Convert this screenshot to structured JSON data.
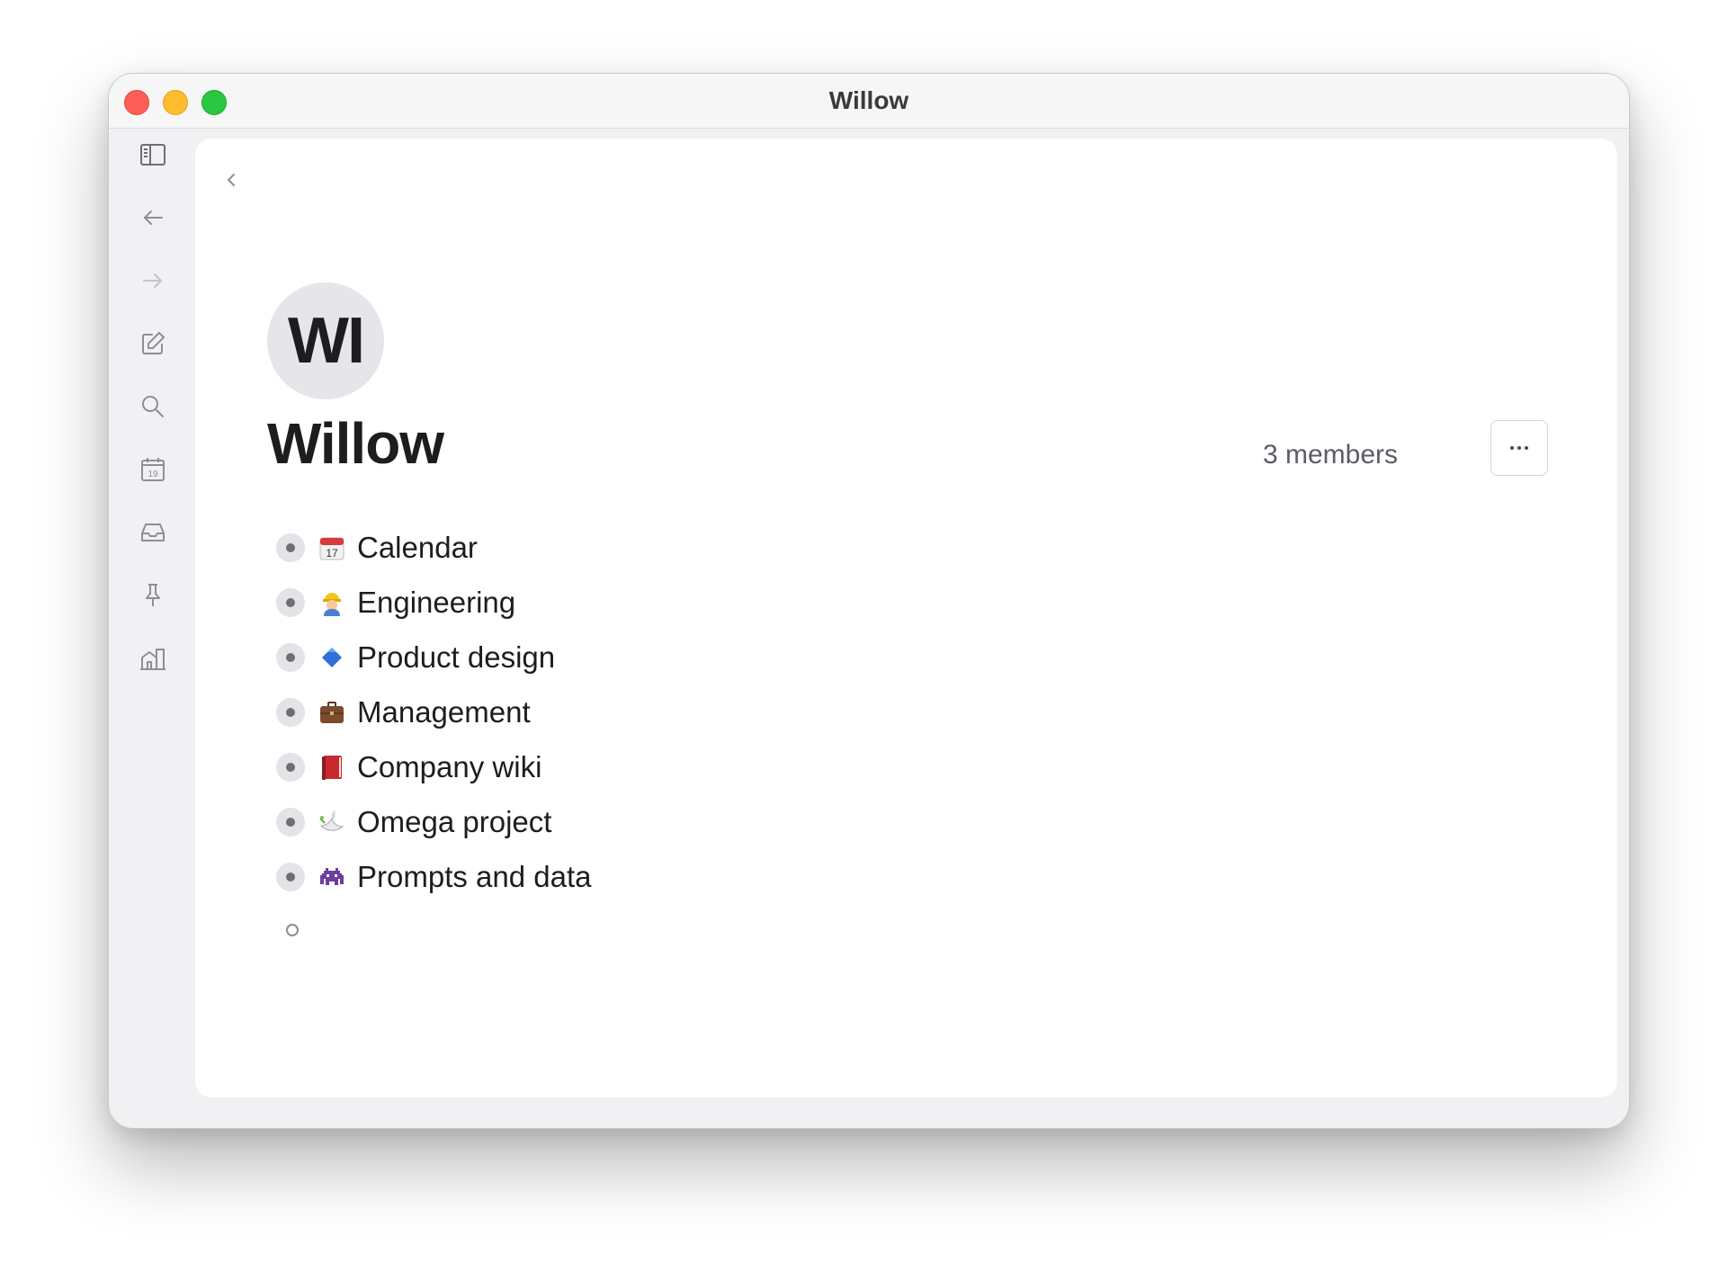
{
  "window": {
    "title": "Willow"
  },
  "sidebar": {
    "icons": [
      "sidebar-toggle-icon",
      "back-arrow-icon",
      "forward-arrow-icon",
      "compose-icon",
      "search-icon",
      "calendar-19-icon",
      "inbox-icon",
      "pin-icon",
      "buildings-icon",
      "more-icon"
    ],
    "calendar_day": "19"
  },
  "workspace": {
    "avatar_initials": "WI",
    "name": "Willow",
    "members": "3 members",
    "more_label": "···"
  },
  "items": [
    {
      "emoji": "calendar-17-emoji",
      "label": "Calendar"
    },
    {
      "emoji": "construction-worker-emoji",
      "label": "Engineering"
    },
    {
      "emoji": "blue-diamond-emoji",
      "label": "Product design"
    },
    {
      "emoji": "briefcase-emoji",
      "label": "Management"
    },
    {
      "emoji": "red-book-emoji",
      "label": "Company wiki"
    },
    {
      "emoji": "dove-emoji",
      "label": "Omega project"
    },
    {
      "emoji": "space-invader-emoji",
      "label": "Prompts and data"
    }
  ],
  "colors": {
    "close": "#fe5f57",
    "minimize": "#febc2e",
    "maximize": "#28c840",
    "icon_gray": "#8e8e96"
  }
}
